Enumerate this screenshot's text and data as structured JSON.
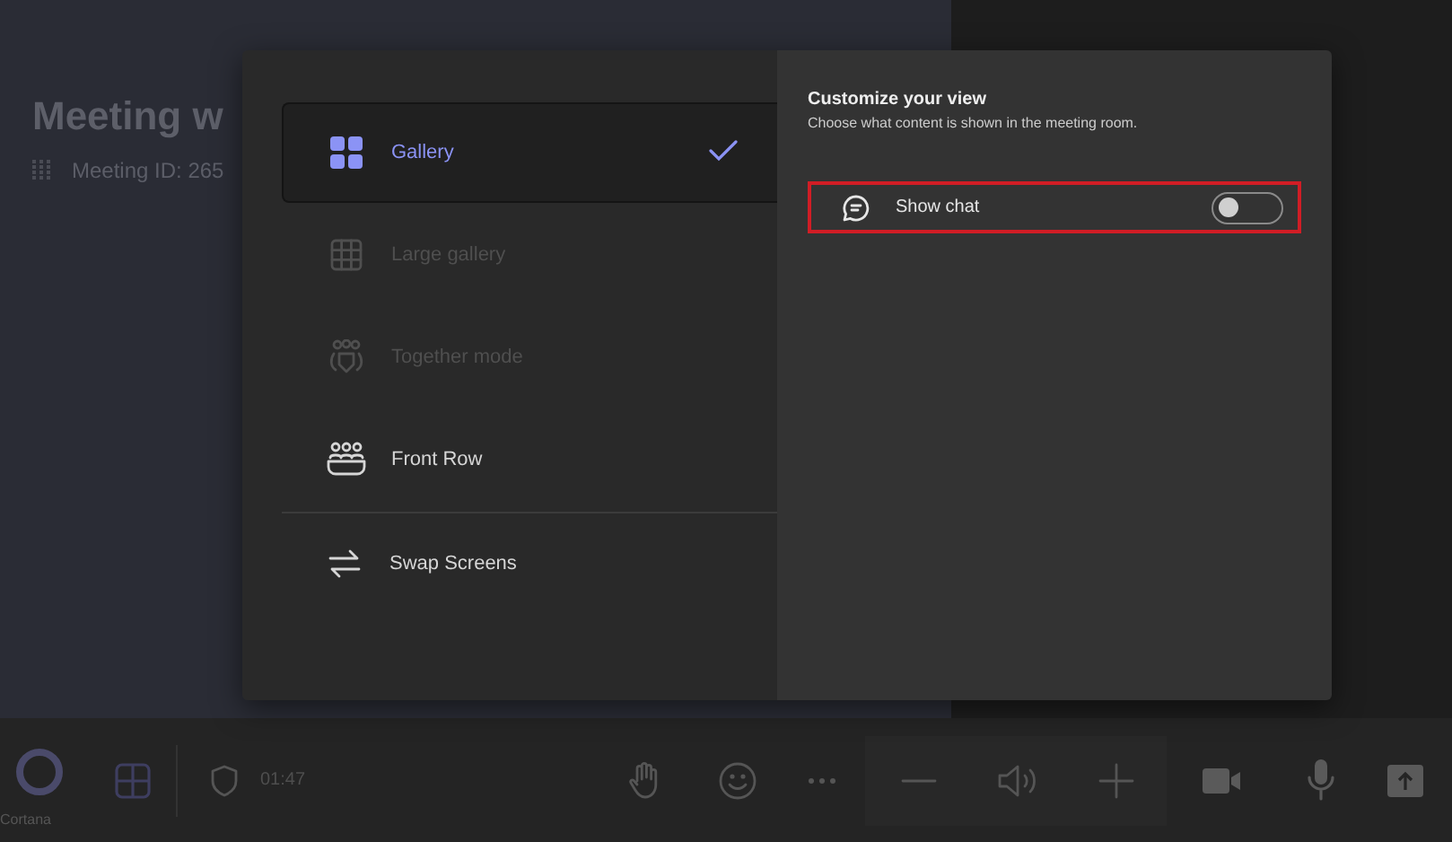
{
  "meeting": {
    "title": "Meeting w",
    "meeting_id": "Meeting ID: 265"
  },
  "view_dialog": {
    "layouts": [
      {
        "label": "Gallery",
        "selected": true,
        "disabled": false
      },
      {
        "label": "Large gallery",
        "selected": false,
        "disabled": true
      },
      {
        "label": "Together mode",
        "selected": false,
        "disabled": true
      },
      {
        "label": "Front Row",
        "selected": false,
        "disabled": false
      }
    ],
    "swap_screens": {
      "label": "Swap Screens"
    },
    "customize": {
      "title": "Customize your view",
      "subtitle": "Choose what content is shown in the meeting room.",
      "options": [
        {
          "label": "Show chat",
          "on": false,
          "highlighted": true
        }
      ]
    }
  },
  "toolbar": {
    "cortana_label": "Cortana",
    "timer": "01:47"
  }
}
